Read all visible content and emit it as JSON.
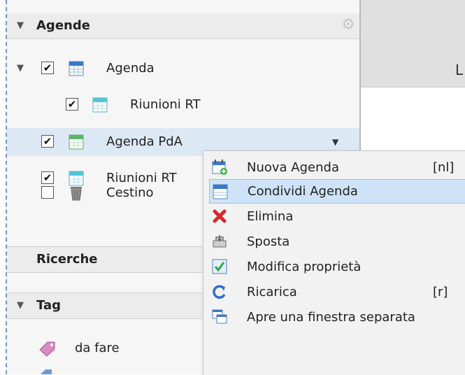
{
  "sidebar": {
    "agende": {
      "title": "Agende"
    },
    "items": [
      {
        "label": "Agenda",
        "checked": true
      },
      {
        "label": "Riunioni RT",
        "checked": true
      },
      {
        "label": "Agenda PdA",
        "checked": true,
        "selected": true
      },
      {
        "label": "Riunioni RT",
        "checked": true
      },
      {
        "label": "Cestino",
        "checked": false
      }
    ],
    "ricerche": {
      "title": "Ricerche"
    },
    "tag": {
      "title": "Tag",
      "items": [
        {
          "label": "da fare"
        }
      ]
    }
  },
  "main": {
    "header_letter": "L"
  },
  "context_menu": {
    "items": [
      {
        "label": "Nuova Agenda",
        "shortcut": "[nl]",
        "icon": "new-calendar-icon"
      },
      {
        "label": "Condividi Agenda",
        "shortcut": "",
        "icon": "calendar-icon",
        "hover": true
      },
      {
        "label": "Elimina",
        "shortcut": "",
        "icon": "delete-x-icon"
      },
      {
        "label": "Sposta",
        "shortcut": "",
        "icon": "move-icon"
      },
      {
        "label": "Modifica proprietà",
        "shortcut": "",
        "icon": "properties-check-icon"
      },
      {
        "label": "Ricarica",
        "shortcut": "[r]",
        "icon": "reload-icon"
      },
      {
        "label": "Apre una finestra separata",
        "shortcut": "",
        "icon": "new-window-icon"
      }
    ]
  },
  "colors": {
    "selection": "#dde8f5",
    "menu_hover": "#cfe3f8",
    "accent_blue": "#2a6fd6"
  }
}
